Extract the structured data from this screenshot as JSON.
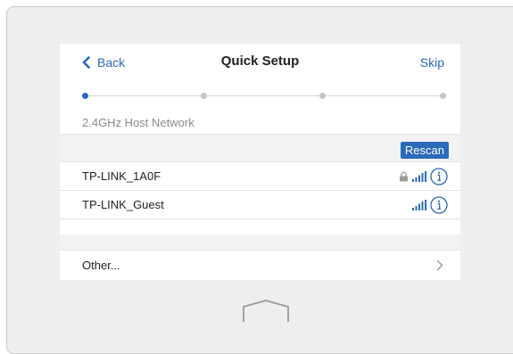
{
  "header": {
    "back_label": "Back",
    "title": "Quick Setup",
    "skip_label": "Skip"
  },
  "progress": {
    "total_steps": 4,
    "current_step": 1
  },
  "step_label": "2.4GHz Host Network",
  "toolbar": {
    "rescan_label": "Rescan"
  },
  "networks": [
    {
      "name": "TP-LINK_1A0F",
      "secured": true,
      "signal_icon": "signal-bars-icon",
      "info_icon": "info-icon"
    },
    {
      "name": "TP-LINK_Guest",
      "secured": false,
      "signal_icon": "signal-bars-icon",
      "info_icon": "info-icon"
    }
  ],
  "other": {
    "label": "Other...",
    "icon": "chevron-right-icon"
  },
  "device": {
    "home_icon": "home-icon"
  },
  "colors": {
    "accent": "#2a6ab8",
    "device_bezel": "#eeeeee",
    "band": "#f2f2f2",
    "muted_text": "#8a8a8a"
  }
}
